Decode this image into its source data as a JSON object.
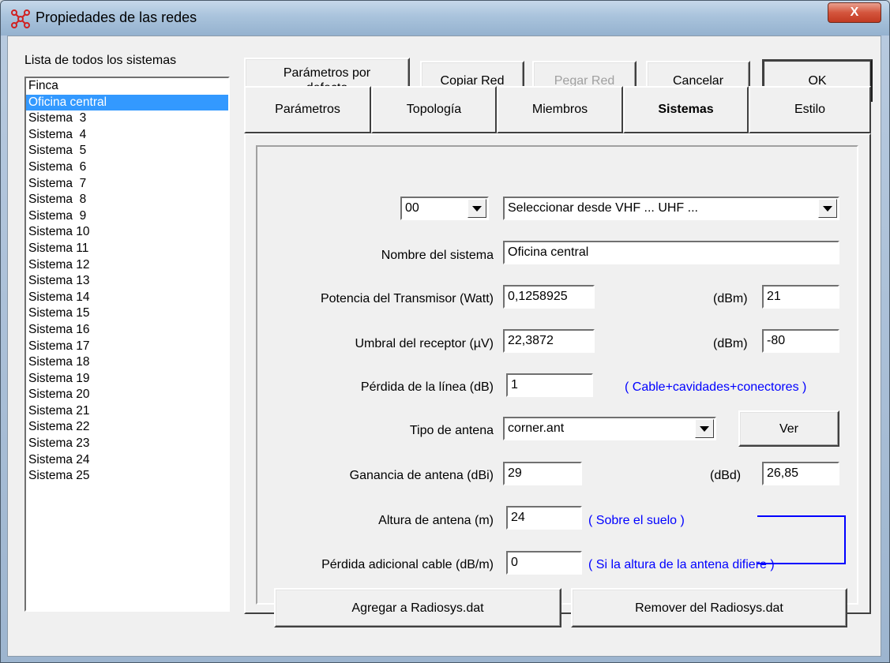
{
  "window": {
    "title": "Propiedades de las redes",
    "close_label": "X"
  },
  "list": {
    "label": "Lista de todos los sistemas",
    "items": [
      "Finca",
      "Oficina central",
      "Sistema  3",
      "Sistema  4",
      "Sistema  5",
      "Sistema  6",
      "Sistema  7",
      "Sistema  8",
      "Sistema  9",
      "Sistema 10",
      "Sistema 11",
      "Sistema 12",
      "Sistema 13",
      "Sistema 14",
      "Sistema 15",
      "Sistema 16",
      "Sistema 17",
      "Sistema 18",
      "Sistema 19",
      "Sistema 20",
      "Sistema 21",
      "Sistema 22",
      "Sistema 23",
      "Sistema 24",
      "Sistema 25"
    ],
    "selected_index": 1
  },
  "toolbar": {
    "defaults_line1": "Parámetros por",
    "defaults_line2": "defecto",
    "copy": "Copiar Red",
    "paste": "Pegar Red",
    "cancel": "Cancelar",
    "ok": "OK"
  },
  "tabs": [
    {
      "label": "Parámetros"
    },
    {
      "label": "Topología"
    },
    {
      "label": "Miembros"
    },
    {
      "label": "Sistemas",
      "active": true
    },
    {
      "label": "Estilo"
    }
  ],
  "form": {
    "system_number": "00",
    "band_select": "Seleccionar desde VHF ... UHF ...",
    "name_label": "Nombre del sistema",
    "name_value": "Oficina central",
    "tx_label": "Potencia del Transmisor (Watt)",
    "tx_watt": "0,1258925",
    "tx_dbm_label": "(dBm)",
    "tx_dbm": "21",
    "rx_label": "Umbral del receptor (µV)",
    "rx_uv": "22,3872",
    "rx_dbm_label": "(dBm)",
    "rx_dbm": "-80",
    "loss_label": "Pérdida de la línea (dB)",
    "loss_value": "1",
    "loss_note": "( Cable+cavidades+conectores )",
    "antenna_label": "Tipo de antena",
    "antenna_value": "corner.ant",
    "view_button": "Ver",
    "gain_label": "Ganancia de antena (dBi)",
    "gain_dbi": "29",
    "gain_dbd_label": "(dBd)",
    "gain_dbd": "26,85",
    "height_label": "Altura de antena (m)",
    "height_value": "24",
    "height_note": "( Sobre el suelo )",
    "extra_loss_label": "Pérdida adicional cable (dB/m)",
    "extra_loss_value": "0",
    "extra_loss_note": "( Si la altura de la antena difiere )",
    "add_button": "Agregar a Radiosys.dat",
    "remove_button": "Remover del Radiosys.dat"
  }
}
